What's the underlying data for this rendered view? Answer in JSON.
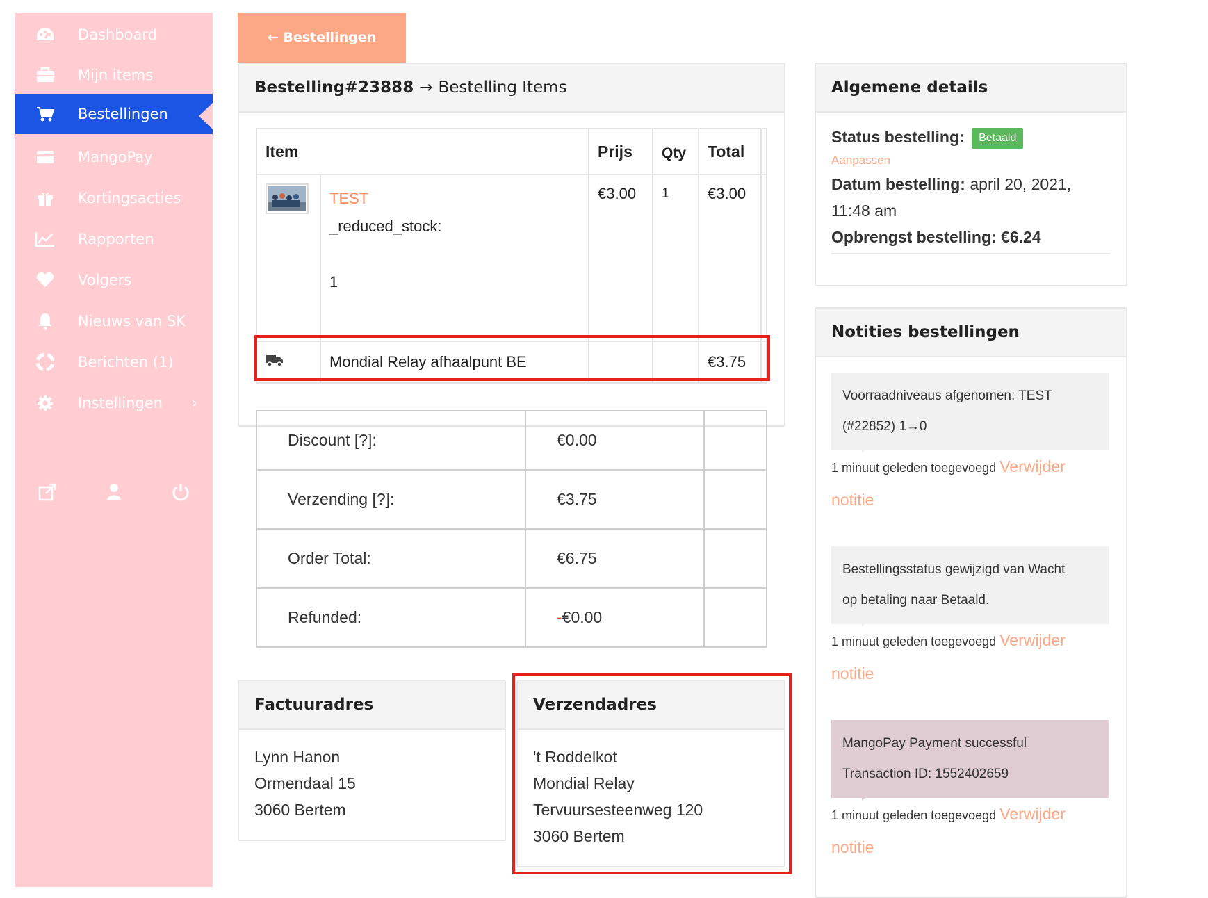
{
  "sidebar": {
    "items": [
      {
        "label": "Dashboard",
        "icon": "dashboard-icon"
      },
      {
        "label": "Mijn items",
        "icon": "briefcase-icon"
      },
      {
        "label": "Bestellingen",
        "icon": "cart-icon",
        "active": true
      },
      {
        "label": "MangoPay",
        "icon": "credit-card-icon"
      },
      {
        "label": "Kortingsacties",
        "icon": "gift-icon"
      },
      {
        "label": "Rapporten",
        "icon": "chart-icon"
      },
      {
        "label": "Volgers",
        "icon": "heart-icon"
      },
      {
        "label": "Nieuws van SK",
        "icon": "bell-icon"
      },
      {
        "label": "Berichten (1)",
        "icon": "lifebuoy-icon"
      },
      {
        "label": "Instellingen",
        "icon": "gear-icon",
        "arrow": "›"
      }
    ],
    "footer_icons": [
      "external-link-icon",
      "user-icon",
      "power-icon"
    ],
    "bg_color": "#ffcdd2",
    "active_color": "#1a55e3"
  },
  "back_button": {
    "label": "← Bestellingen",
    "color": "#fca785"
  },
  "order_panel": {
    "title_bold": "Bestelling#23888",
    "title_arrow": "→",
    "title_rest": "Bestelling Items",
    "columns": [
      "Item",
      "Prijs",
      "Qty",
      "Total"
    ],
    "item": {
      "name": "TEST",
      "meta_key": "_reduced_stock:",
      "meta_value": "1",
      "price": "€3.00",
      "qty": "1",
      "total": "€3.00"
    },
    "shipping": {
      "label": "Mondial Relay afhaalpunt BE",
      "total": "€3.75",
      "icon": "truck-icon"
    }
  },
  "totals": [
    {
      "label": "Discount [?]:",
      "value": "€0.00"
    },
    {
      "label": "Verzending [?]:",
      "value": "€3.75"
    },
    {
      "label": "Order Total:",
      "value": "€6.75"
    },
    {
      "label": "Refunded:",
      "value_prefix": "-",
      "value": "€0.00",
      "refund": true
    }
  ],
  "billing": {
    "title": "Factuuradres",
    "lines": [
      "Lynn Hanon",
      "Ormendaal 15",
      "3060 Bertem"
    ]
  },
  "shipping_address": {
    "title": "Verzendadres",
    "lines": [
      "'t Roddelkot",
      "Mondial Relay",
      "Tervuursesteenweg 120",
      "3060 Bertem"
    ]
  },
  "general": {
    "title": "Algemene details",
    "status_label": "Status bestelling:",
    "status_badge": "Betaald",
    "status_badge_color": "#5cb85c",
    "edit_link": "Aanpassen",
    "date_label": "Datum bestelling:",
    "date_value": "april 20, 2021,",
    "time_value": "11:48 am",
    "revenue_label": "Opbrengst bestelling:",
    "revenue_value": "€6.24"
  },
  "notes": {
    "title": "Notities bestellingen",
    "items": [
      {
        "line1": "Voorraadniveaus afgenomen: TEST",
        "line2": "(#22852) 1→0",
        "meta": "1 minuut geleden toegevoegd",
        "delete1": "Verwijder",
        "delete2": "notitie"
      },
      {
        "line1": "Bestellingsstatus gewijzigd van Wacht",
        "line2": "op betaling naar Betaald.",
        "meta": "1 minuut geleden toegevoegd",
        "delete1": "Verwijder",
        "delete2": "notitie"
      },
      {
        "line1": "MangoPay Payment successful",
        "line2": "Transaction ID: 1552402659",
        "meta": "1 minuut geleden toegevoegd",
        "delete1": "Verwijder",
        "delete2": "notitie"
      }
    ]
  }
}
